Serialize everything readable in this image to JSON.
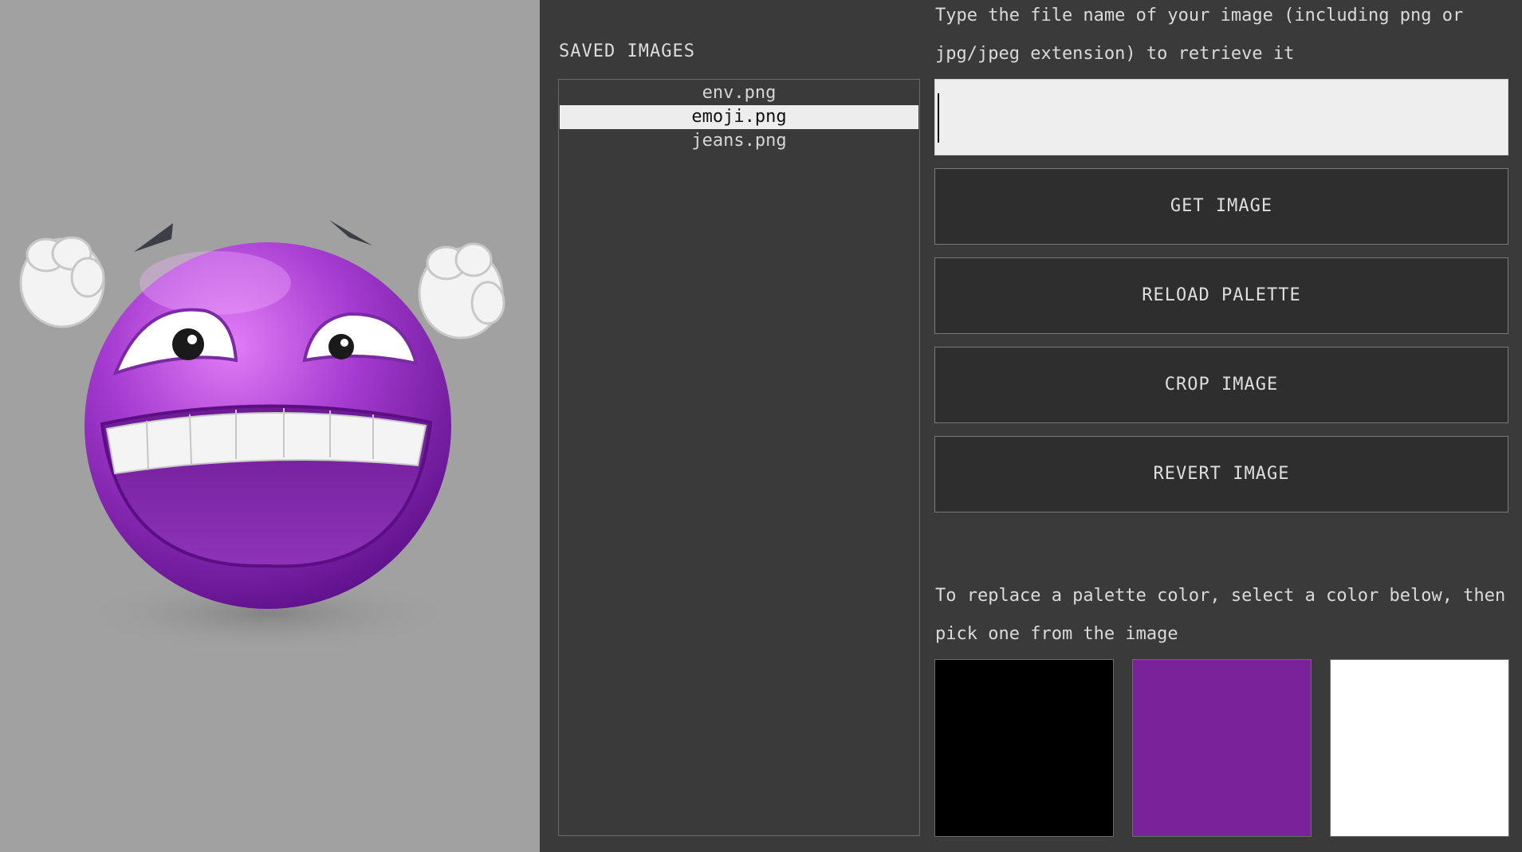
{
  "canvas": {
    "image_name": "emoji.png",
    "background_color": "#a1a1a1"
  },
  "saved_images": {
    "title": "SAVED IMAGES",
    "items": [
      "env.png",
      "emoji.png",
      "jeans.png"
    ],
    "selected": "emoji.png"
  },
  "retrieve": {
    "instruction_line1": "Type the file name of your image (including png or",
    "instruction_line2": "jpg/jpeg extension) to retrieve it",
    "input_value": ""
  },
  "buttons": {
    "get_image": "GET IMAGE",
    "reload_palette": "RELOAD PALETTE",
    "crop_image": "CROP IMAGE",
    "revert_image": "REVERT IMAGE"
  },
  "palette": {
    "instruction_line1": "To replace a palette color, select a color below, then",
    "instruction_line2": "pick one from the image",
    "colors": [
      "#000000",
      "#7a2299",
      "#ffffff"
    ]
  }
}
